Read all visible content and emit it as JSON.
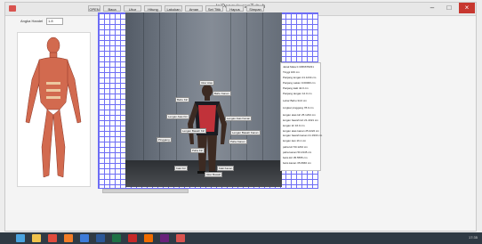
{
  "window": {
    "title": "IniPengukuranTubuh",
    "min_label": "–",
    "max_label": "□",
    "close_label": "×"
  },
  "form": {
    "field_label": "Angka Handel",
    "field_value": "1.8"
  },
  "toolbar": {
    "buttons": [
      "OPEN",
      "Baca",
      "Ukur",
      "Hitung",
      "Lakukan",
      "Aman",
      "Set Titik",
      "Hapus",
      "Simpan"
    ]
  },
  "tags": [
    {
      "label": "Ukur Atas"
    },
    {
      "label": "Ukur Bawah"
    },
    {
      "label": "Bahu Kiri"
    },
    {
      "label": "Bahu Kanan"
    },
    {
      "label": "Lengan Atas Kiri"
    },
    {
      "label": "Lengan Atas Kanan"
    },
    {
      "label": "Lengan Bawah Kiri"
    },
    {
      "label": "Lengan Bawah Kanan"
    },
    {
      "label": "Pinggang"
    },
    {
      "label": "Paha Kiri"
    },
    {
      "label": "Paha Kanan"
    },
    {
      "label": "Kaki Kiri"
    },
    {
      "label": "Kaki Kanan"
    }
  ],
  "info_rows": [
    "Jarak Mata   0.3456678231",
    "Tinggi          160     cm",
    "Panjang lengan    21.1234 cm",
    "Panjang Lakan   0.00000 cm",
    "Panjang kaki     42.0   cm",
    "Panjang tangan   12.0   cm",
    "Lebar Bahu      34.0   cm",
    "Lingkar pinggang   78.0  cm",
    "lengan atas kiri    25.1234 cm",
    "lengan bawah kiri  21.4321 cm",
    "lengan kir       16.0 cm",
    "lengan atas kanan  25.2222 cm",
    "lengan bawah kanan  21.3333 cm",
    "lengan kan      16.1 cm",
    "paha kiri     50.1234 cm",
    "paha kanan    50.2345 cm",
    "betis kiri    35.5555 cm",
    "betis kanan    35.6666 cm"
  ],
  "taskbar": {
    "icons": [
      "windows-start",
      "explorer",
      "chrome",
      "firefox",
      "media",
      "word",
      "excel",
      "acrobat",
      "vlc",
      "visual-studio",
      "app"
    ],
    "icon_colors": [
      "#4aa3df",
      "#f0c24b",
      "#e04b3c",
      "#f27d27",
      "#3d7bd9",
      "#2b5797",
      "#1e7145",
      "#c62828",
      "#ef6c00",
      "#68217a",
      "#d9534f"
    ],
    "clock": "17:35"
  }
}
